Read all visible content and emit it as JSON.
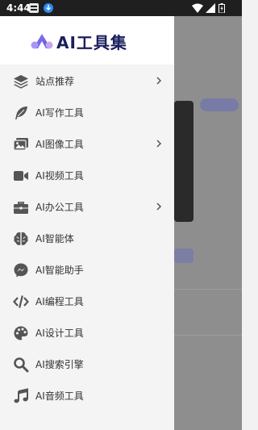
{
  "status_bar": {
    "time": "4:44"
  },
  "brand": {
    "title": "AI工具集"
  },
  "menu": [
    {
      "label": "站点推荐",
      "icon": "layers-icon",
      "chevron": true
    },
    {
      "label": "AI写作工具",
      "icon": "feather-icon",
      "chevron": false
    },
    {
      "label": "AI图像工具",
      "icon": "images-icon",
      "chevron": true
    },
    {
      "label": "AI视频工具",
      "icon": "video-camera-icon",
      "chevron": false
    },
    {
      "label": "AI办公工具",
      "icon": "briefcase-icon",
      "chevron": true
    },
    {
      "label": "AI智能体",
      "icon": "brain-icon",
      "chevron": false
    },
    {
      "label": "AI智能助手",
      "icon": "messenger-icon",
      "chevron": false
    },
    {
      "label": "AI编程工具",
      "icon": "code-icon",
      "chevron": false
    },
    {
      "label": "AI设计工具",
      "icon": "palette-icon",
      "chevron": false
    },
    {
      "label": "AI搜索引擎",
      "icon": "search-icon",
      "chevron": false
    },
    {
      "label": "AI音频工具",
      "icon": "music-note-icon",
      "chevron": false
    }
  ],
  "colors": {
    "brand": "#1a1f5c",
    "logo_purple": "#7b6cf0",
    "icon": "#555555"
  }
}
